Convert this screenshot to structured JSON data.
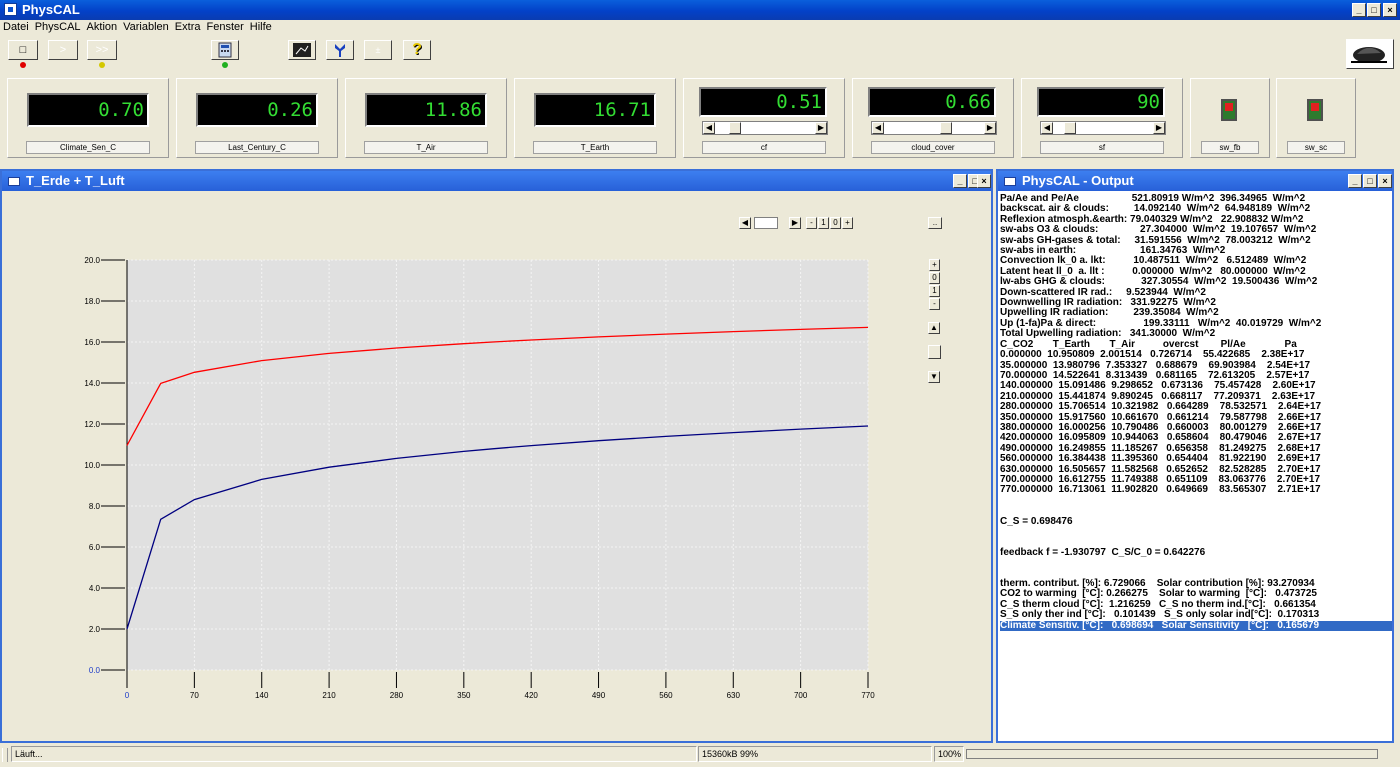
{
  "app": {
    "title": "PhysCAL"
  },
  "menu": [
    "Datei",
    "PhysCAL",
    "Aktion",
    "Variablen",
    "Extra",
    "Fenster",
    "Hilfe"
  ],
  "window_controls": [
    "_",
    "□",
    "×"
  ],
  "toolbar": {
    "stop_symbol": "□",
    "step_symbol": ">",
    "run_symbol": ">>",
    "calc_symbol": "±",
    "info_symbol": "?"
  },
  "panels": [
    {
      "label": "Climate_Sen_C",
      "value": "0.70"
    },
    {
      "label": "Last_Century_C",
      "value": "0.26"
    },
    {
      "label": "T_Air",
      "value": "11.86"
    },
    {
      "label": "T_Earth",
      "value": "16.71"
    },
    {
      "label": "cf",
      "value": "0.51",
      "slider": 0.15
    },
    {
      "label": "cloud_cover",
      "value": "0.66",
      "slider": 0.62
    },
    {
      "label": "sf",
      "value": "90",
      "slider": 0.12
    }
  ],
  "switches": [
    {
      "label": "sw_fb"
    },
    {
      "label": "sw_sc"
    }
  ],
  "chart_window": {
    "title": "T_Erde + T_Luft"
  },
  "chart_controls": {
    "zoom_buttons": [
      "-",
      "1",
      "0",
      "+"
    ],
    "vzoom_buttons": [
      "+",
      "0",
      "1",
      "-"
    ],
    "more": ".."
  },
  "chart_data": {
    "type": "line",
    "title": "",
    "xlabel": "",
    "ylabel": "",
    "xlim": [
      0,
      770
    ],
    "ylim": [
      0,
      20
    ],
    "grid": true,
    "xticks": [
      "0",
      "70",
      "140",
      "210",
      "280",
      "350",
      "420",
      "490",
      "560",
      "630",
      "700",
      "770"
    ],
    "yticks": [
      "0.0",
      "2.0",
      "4.0",
      "6.0",
      "8.0",
      "10.0",
      "12.0",
      "14.0",
      "16.0",
      "18.0",
      "20.0"
    ],
    "x": [
      0,
      35,
      70,
      140,
      210,
      280,
      350,
      380,
      420,
      490,
      560,
      630,
      700,
      770
    ],
    "series": [
      {
        "color": "#ff0000",
        "values": [
          10.950809,
          13.980796,
          14.522641,
          15.091486,
          15.441874,
          15.706514,
          15.91756,
          16.000256,
          16.095809,
          16.249855,
          16.384438,
          16.505657,
          16.612755,
          16.713061
        ]
      },
      {
        "color": "#000080",
        "values": [
          2.001514,
          7.353327,
          8.313439,
          9.298652,
          9.890245,
          10.321982,
          10.66167,
          10.790486,
          10.944063,
          11.185267,
          11.39536,
          11.582568,
          11.749388,
          11.90282
        ]
      }
    ]
  },
  "output_window": {
    "title": "PhysCAL - Output",
    "lines": [
      "Pa/Ae and Pe/Ae                   521.80919 W/m^2  396.34965  W/m^2",
      "backscat. air & clouds:         14.092140  W/m^2  64.948189  W/m^2",
      "Reflexion atmosph.&earth: 79.040329 W/m^2   22.908832 W/m^2",
      "sw-abs O3 & clouds:               27.304000  W/m^2  19.107657  W/m^2",
      "sw-abs GH-gases & total:     31.591556  W/m^2  78.003212  W/m^2",
      "sw-abs in earth:                       161.34763  W/m^2",
      "Convection lk_0 a. lkt:          10.487511  W/m^2   6.512489  W/m^2",
      "Latent heat ll_0  a. llt :          0.000000  W/m^2   80.000000  W/m^2",
      "lw-abs GHG & clouds:             327.30554  W/m^2  19.500436  W/m^2",
      "Down-scattered IR rad.:     9.523944  W/m^2",
      "Downwelling IR radiation:   331.92275  W/m^2",
      "Upwelling IR radiation:         239.35084  W/m^2",
      "Up (1-fa)Pa & direct:                 199.33111   W/m^2  40.019729  W/m^2",
      "Total Upwelling radiation:   341.30000  W/m^2",
      "C_CO2       T_Earth       T_Air          overcst        Pl/Ae              Pa",
      "0.000000  10.950809  2.001514   0.726714    55.422685    2.38E+17",
      "35.000000  13.980796  7.353327   0.688679    69.903984    2.54E+17",
      "70.000000  14.522641  8.313439   0.681165    72.613205    2.57E+17",
      "140.000000  15.091486  9.298652   0.673136    75.457428    2.60E+17",
      "210.000000  15.441874  9.890245   0.668117    77.209371    2.63E+17",
      "280.000000  15.706514  10.321982   0.664289    78.532571    2.64E+17",
      "350.000000  15.917560  10.661670   0.661214    79.587798    2.66E+17",
      "380.000000  16.000256  10.790486   0.660003    80.001279    2.66E+17",
      "420.000000  16.095809  10.944063   0.658604    80.479046    2.67E+17",
      "490.000000  16.249855  11.185267   0.656358    81.249275    2.68E+17",
      "560.000000  16.384438  11.395360   0.654404    81.922190    2.69E+17",
      "630.000000  16.505657  11.582568   0.652652    82.528285    2.70E+17",
      "700.000000  16.612755  11.749388   0.651109    83.063776    2.70E+17",
      "770.000000  16.713061  11.902820   0.649669    83.565307    2.71E+17",
      "",
      "",
      "C_S = 0.698476",
      "",
      "",
      "feedback f = -1.930797  C_S/C_0 = 0.642276",
      "",
      "",
      "therm. contribut. [%]: 6.729066    Solar contribution [%]: 93.270934",
      "CO2 to warming  [°C]: 0.266275    Solar to warming  [°C]:   0.473725",
      "C_S therm cloud [°C]:  1.216259   C_S no therm ind.[°C]:   0.661354",
      "S_S only ther ind [°C]:   0.101439   S_S only solar ind[°C]:  0.170313",
      "Climate Sensitiv. [°C]:   0.698694   Solar Sensitivity   [°C]:   0.165679"
    ]
  },
  "statusbar": {
    "status": "Läuft...",
    "memory": "15360kB 99%",
    "progress": "100%"
  }
}
